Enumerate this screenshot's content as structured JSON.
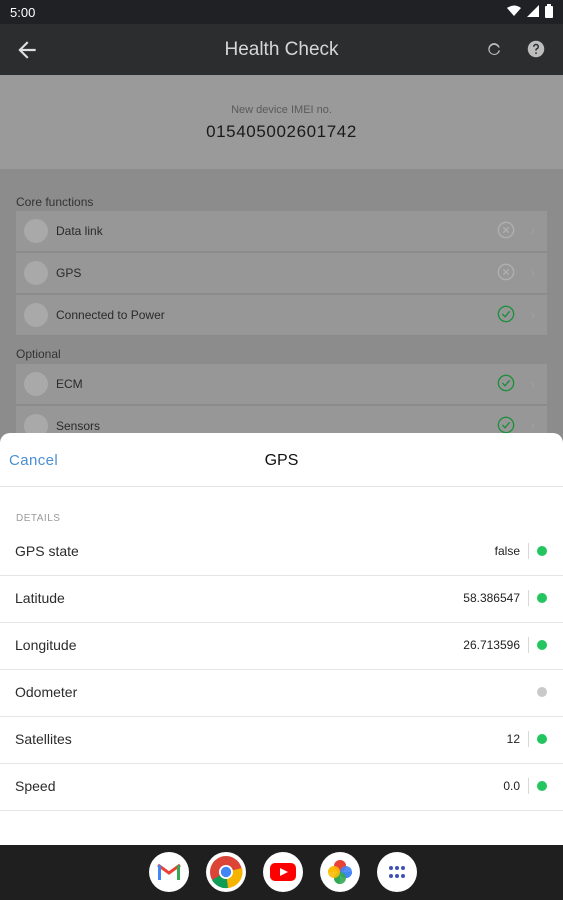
{
  "status_bar": {
    "time": "5:00"
  },
  "app_bar": {
    "title": "Health Check"
  },
  "background": {
    "imei_label": "New device IMEI no.",
    "imei_value": "015405002601742",
    "core_title": "Core functions",
    "core_items": [
      {
        "label": "Data link",
        "status": "error"
      },
      {
        "label": "GPS",
        "status": "error"
      },
      {
        "label": "Connected to Power",
        "status": "ok"
      }
    ],
    "optional_title": "Optional",
    "optional_items": [
      {
        "label": "ECM",
        "status": "ok"
      },
      {
        "label": "Sensors",
        "status": "ok"
      }
    ]
  },
  "sheet": {
    "cancel_label": "Cancel",
    "title": "GPS",
    "details_label": "DETAILS",
    "rows": [
      {
        "key": "GPS state",
        "value": "false",
        "dot": "#22c55e"
      },
      {
        "key": "Latitude",
        "value": "58.386547",
        "dot": "#22c55e"
      },
      {
        "key": "Longitude",
        "value": "26.713596",
        "dot": "#22c55e"
      },
      {
        "key": "Odometer",
        "value": "",
        "dot": "#c9c9c9"
      },
      {
        "key": "Satellites",
        "value": "12",
        "dot": "#22c55e"
      },
      {
        "key": "Speed",
        "value": "0.0",
        "dot": "#22c55e"
      }
    ]
  },
  "dock": {
    "apps": [
      "gmail-icon",
      "chrome-icon",
      "youtube-icon",
      "photos-icon",
      "app-drawer-icon"
    ]
  }
}
